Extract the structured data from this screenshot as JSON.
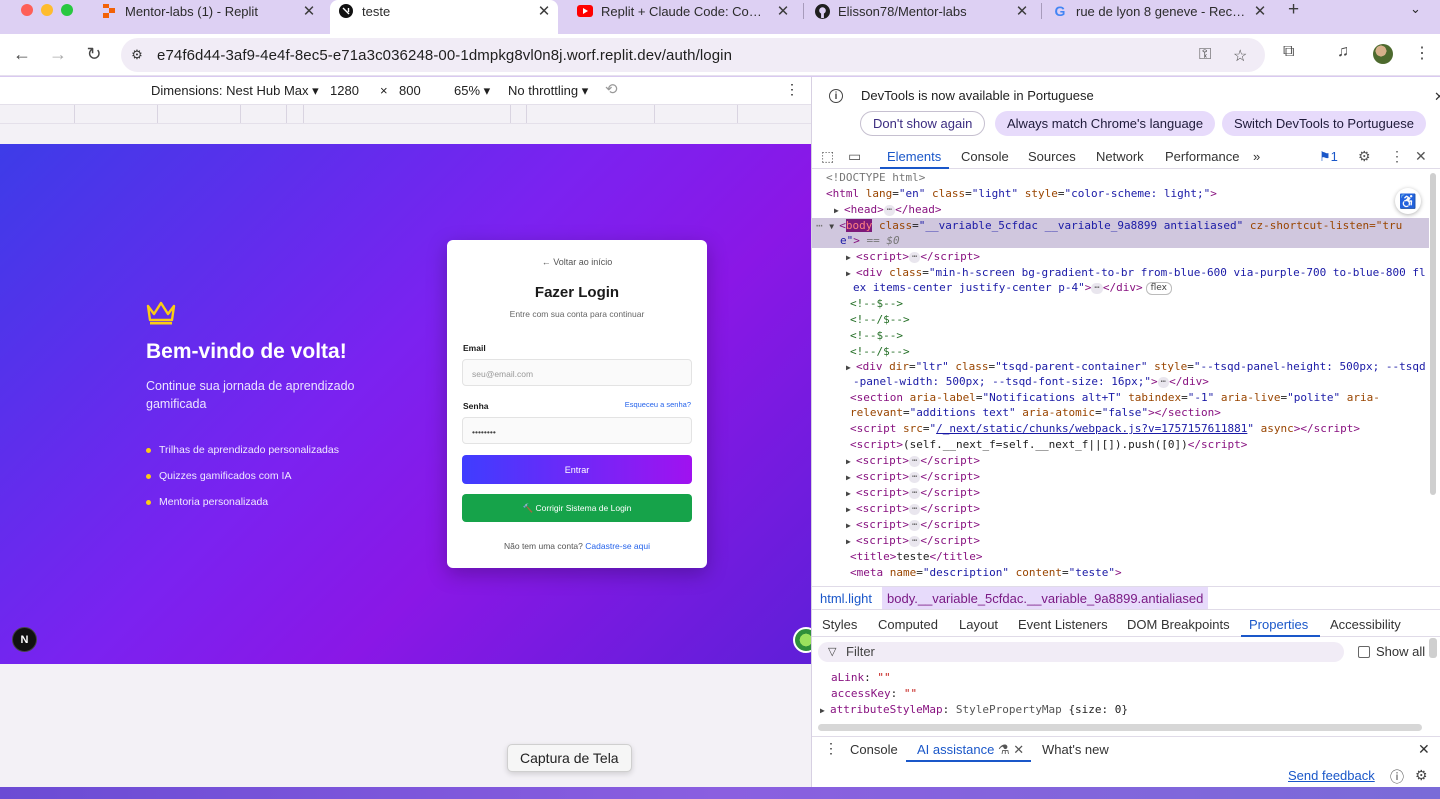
{
  "tabs": [
    {
      "title": "Mentor-labs (1) - Replit",
      "favicon": "replit-icon"
    },
    {
      "title": "teste",
      "favicon": "nextjs-icon",
      "active": true
    },
    {
      "title": "Replit + Claude Code: Como u",
      "favicon": "youtube-icon"
    },
    {
      "title": "Elisson78/Mentor-labs",
      "favicon": "github-icon"
    },
    {
      "title": "rue de lyon 8 geneve - Reche",
      "favicon": "google-icon"
    }
  ],
  "address": {
    "url": "e74f6d44-3af9-4e4f-8ec5-e71a3c036248-00-1dmpkg8vl0n8j.worf.replit.dev/auth/login"
  },
  "device_toolbar": {
    "dimensions": "Dimensions: Nest Hub Max",
    "width": "1280",
    "times": "×",
    "height": "800",
    "zoom": "65%",
    "throttling": "No throttling"
  },
  "page": {
    "hero": {
      "title": "Bem-vindo de volta!",
      "subtitle": "Continue sua jornada de aprendizado gamificada",
      "features": [
        "Trilhas de aprendizado personalizadas",
        "Quizzes gamificados com IA",
        "Mentoria personalizada"
      ]
    },
    "login": {
      "back": "← Voltar ao início",
      "title": "Fazer Login",
      "subtitle": "Entre com sua conta para continuar",
      "email_label": "Email",
      "email_placeholder": "seu@email.com",
      "password_label": "Senha",
      "forgot": "Esqueceu a senha?",
      "password_value": "••••••••",
      "submit": "Entrar",
      "fix": "🔨 Corrigir Sistema de Login",
      "no_account": "Não tem uma conta?",
      "signup": "Cadastre-se aqui"
    },
    "next_badge": "N"
  },
  "tooltip": "Captura de Tela",
  "devtools": {
    "notice": {
      "message": "DevTools is now available in Portuguese",
      "dont_show": "Don't show again",
      "always_match": "Always match Chrome's language",
      "switch": "Switch DevTools to Portuguese"
    },
    "tabs": [
      "Elements",
      "Console",
      "Sources",
      "Network",
      "Performance"
    ],
    "issues_count": "1",
    "dom": {
      "doctype": "<!DOCTYPE html>",
      "html_attrs": {
        "lang": "en",
        "class": "light",
        "style": "color-scheme: light;"
      },
      "body_class": "__variable_5cfdac __variable_9a8899 antialiased",
      "body_cz_1": "cz-shortcut-listen=\"tru",
      "body_cz_2": "e\"",
      "dollar0": "== $0",
      "div_class_1": "min-h-screen bg-gradient-to-br from-blue-600 via-purple-700 to-blue-800 fl",
      "div_class_2": "ex items-center justify-center p-4",
      "flex_badge": "flex",
      "comments": [
        "<!--$-->",
        "<!--/$-->",
        "<!--$-->",
        "<!--/$-->"
      ],
      "tsqd_line1_class": "tsqd-parent-container",
      "tsqd_line1_style": "--tsqd-panel-height: 500px; --tsqd",
      "tsqd_line2": "-panel-width: 500px; --tsqd-font-size: 16px;",
      "section_label": "Notifications alt+T",
      "section_tabindex": "-1",
      "section_live": "polite",
      "section_aria_prefix": "aria-",
      "section_relevant": "additions text",
      "section_atomic": "false",
      "script_src": "/_next/static/chunks/webpack.js?v=1757157611881",
      "script_inline": "(self.__next_f=self.__next_f||[]).push([0])",
      "title_text": "teste",
      "meta_name": "description",
      "meta_content": "teste"
    },
    "breadcrumbs": [
      "html.light",
      "body.__variable_5cfdac.__variable_9a8899.antialiased"
    ],
    "subtabs": [
      "Styles",
      "Computed",
      "Layout",
      "Event Listeners",
      "DOM Breakpoints",
      "Properties",
      "Accessibility"
    ],
    "filter_placeholder": "Filter",
    "show_all": "Show all",
    "properties": [
      {
        "key": "aLink",
        "value": "\"\""
      },
      {
        "key": "accessKey",
        "value": "\"\""
      },
      {
        "key": "attributeStyleMap",
        "value": "StylePropertyMap",
        "extra": "{size: 0}"
      }
    ],
    "drawer_tabs": [
      "Console",
      "AI assistance",
      "What's new"
    ],
    "send_feedback": "Send feedback"
  },
  "colors": {
    "accent": "#1a57c9",
    "gradient_start": "#3d3ce8",
    "gradient_end": "#8a17e6",
    "bullet": "#facc15",
    "green_button": "#16a34a"
  }
}
